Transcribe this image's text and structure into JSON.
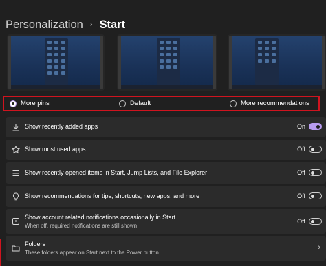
{
  "breadcrumb": {
    "parent": "Personalization",
    "separator": "›",
    "current": "Start"
  },
  "layout_options": [
    {
      "label": "More pins",
      "selected": true
    },
    {
      "label": "Default",
      "selected": false
    },
    {
      "label": "More recommendations",
      "selected": false
    }
  ],
  "settings": [
    {
      "icon": "download-icon",
      "label": "Show recently added apps",
      "state": "On",
      "on": true
    },
    {
      "icon": "star-icon",
      "label": "Show most used apps",
      "state": "Off",
      "on": false
    },
    {
      "icon": "list-icon",
      "label": "Show recently opened items in Start, Jump Lists, and File Explorer",
      "state": "Off",
      "on": false
    },
    {
      "icon": "lightbulb-icon",
      "label": "Show recommendations for tips, shortcuts, new apps, and more",
      "state": "Off",
      "on": false
    },
    {
      "icon": "notification-icon",
      "label": "Show account related notifications occasionally in Start",
      "sub": "When off, required notifications are still shown",
      "state": "Off",
      "on": false
    }
  ],
  "folders": {
    "icon": "folder-icon",
    "label": "Folders",
    "sub": "These folders appear on Start next to the Power button",
    "chevron": "›"
  },
  "colors": {
    "accent": "#b89cf0",
    "highlight": "#d0141f",
    "background": "#202020",
    "card": "#2b2b2b"
  }
}
